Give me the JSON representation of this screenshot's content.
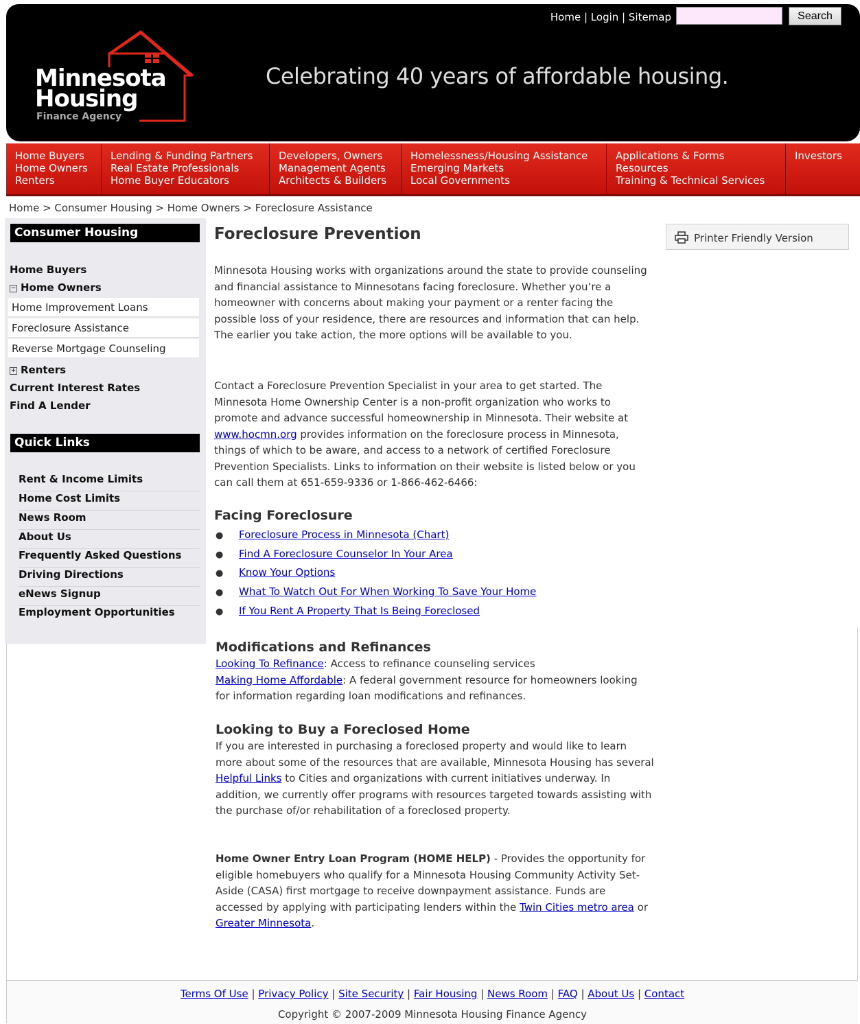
{
  "header": {
    "top_links": [
      "Home",
      "Login",
      "Sitemap"
    ],
    "search_button": "Search",
    "logo_line1": "Minnesota",
    "logo_line2": "Housing",
    "logo_line3": "Finance Agency",
    "tagline": "Celebrating 40 years of affordable housing."
  },
  "nav": [
    [
      "Home Buyers",
      "Home Owners",
      "Renters"
    ],
    [
      "Lending & Funding Partners",
      "Real Estate Professionals",
      "Home Buyer Educators"
    ],
    [
      "Developers, Owners",
      "Management Agents",
      "Architects & Builders"
    ],
    [
      "Homelessness/Housing Assistance",
      "Emerging Markets",
      "Local Governments"
    ],
    [
      "Applications & Forms",
      "Resources",
      "Training & Technical Services"
    ],
    [
      "Investors"
    ]
  ],
  "breadcrumb": "Home > Consumer Housing > Home Owners > Foreclosure Assistance",
  "sidebar": {
    "consumer_heading": "Consumer Housing",
    "home_buyers": "Home Buyers",
    "home_owners": "Home Owners",
    "home_owners_sub": [
      "Home Improvement Loans",
      "Foreclosure Assistance",
      "Reverse Mortgage Counseling"
    ],
    "renters": "Renters",
    "current_rates": "Current Interest Rates",
    "find_lender": "Find A Lender",
    "quick_links_heading": "Quick Links",
    "quick_links": [
      "Rent & Income Limits",
      "Home Cost Limits",
      "News Room",
      "About Us",
      "Frequently Asked Questions",
      "Driving Directions",
      "eNews Signup",
      "Employment Opportunities"
    ]
  },
  "main": {
    "title": "Foreclosure Prevention",
    "printer_label": "Printer Friendly Version",
    "intro": "Minnesota Housing works with organizations around the state to provide counseling and financial assistance to Minnesotans facing foreclosure. Whether you’re a homeowner with concerns about making your payment or a renter facing the possible loss of your residence, there are resources and information that can help. The earlier you take action, the more options will be available to you.",
    "contact_before": "Contact a Foreclosure Prevention Specialist in your area to get started. The Minnesota Home Ownership Center is a non-profit organization who works to promote and advance successful homeownership in Minnesota. Their website at ",
    "contact_link": "www.hocmn.org",
    "contact_after": " provides information on the foreclosure process in Minnesota, things of which to be aware, and access to a network of certified Foreclosure Prevention Specialists. Links to information on their website is listed below or you can call them at 651-659-9336 or 1-866-462-6466:",
    "facing_heading": "Facing Foreclosure",
    "facing_links": [
      "Foreclosure Process in Minnesota (Chart)",
      "Find A Foreclosure Counselor In Your Area",
      "Know Your Options",
      "What To Watch Out For When Working To Save Your Home",
      "If You Rent A Property That Is Being Foreclosed"
    ],
    "mods_heading": "Modifications and Refinances",
    "refi_link": "Looking To Refinance",
    "refi_text": ":  Access to refinance counseling services",
    "mha_link": "Making Home Affordable",
    "mha_text": ":  A federal government resource for homeowners looking for information regarding loan modifications and refinances.",
    "buy_heading": "Looking to Buy a Foreclosed Home",
    "buy_before": "If you are interested in purchasing a foreclosed property and would like to learn more about some of the resources that are available, Minnesota Housing has several ",
    "buy_link": "Helpful Links",
    "buy_after": " to Cities and organizations with current initiatives underway. In addition, we currently offer programs with resources targeted towards assisting with the purchase of/or rehabilitation of a foreclosed property.",
    "help_bold": "Home Owner Entry Loan Program (HOME HELP)",
    "help_text": " - Provides the opportunity for eligible homebuyers who qualify for a Minnesota Housing Community Activity Set-Aside (CASA) first mortgage to receive downpayment assistance. Funds are accessed by applying with participating lenders within the ",
    "help_link1": "Twin Cities metro area",
    "help_or": " or ",
    "help_link2": "Greater Minnesota",
    "help_end": "."
  },
  "footer": {
    "links": [
      "Terms Of Use",
      "Privacy Policy",
      "Site Security",
      "Fair Housing",
      "News Room",
      "FAQ",
      "About Us",
      "Contact"
    ],
    "copyright": "Copyright © 2007-2009 Minnesota Housing Finance Agency"
  },
  "colors": {
    "nav_red": "#d11f14",
    "header_black": "#000000",
    "sidebar_bg": "#ebebef",
    "link_blue": "#0000cc"
  }
}
